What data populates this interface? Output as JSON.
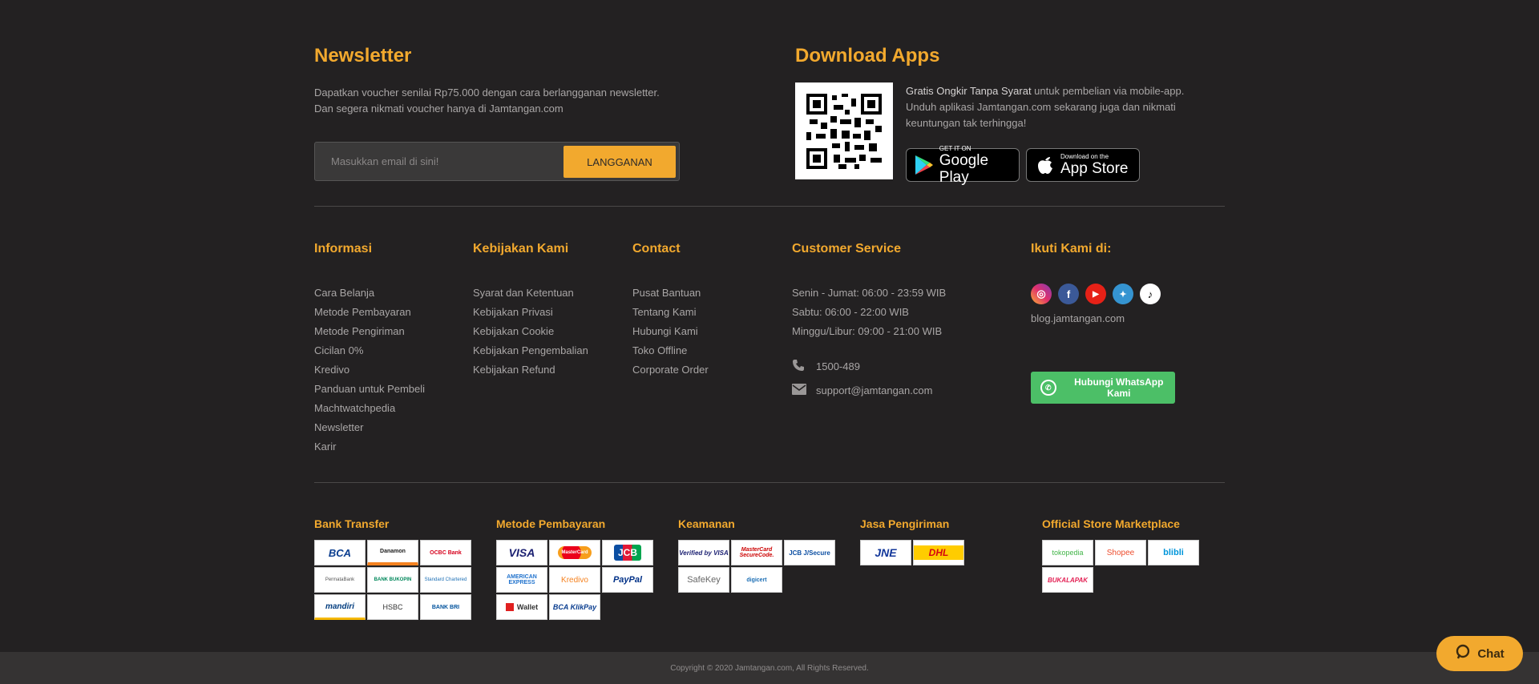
{
  "newsletter": {
    "title": "Newsletter",
    "line1": "Dapatkan voucher senilai Rp75.000 dengan cara berlangganan newsletter.",
    "line2": "Dan segera nikmati voucher hanya di Jamtangan.com",
    "placeholder": "Masukkan email di sini!",
    "button": "LANGGANAN"
  },
  "apps": {
    "title": "Download Apps",
    "highlight": "Gratis Ongkir Tanpa Syarat",
    "rest": " untuk pembelian via mobile-app.",
    "line2": "Unduh aplikasi Jamtangan.com sekarang juga dan nikmati",
    "line3": "keuntungan tak terhingga!",
    "google_small": "GET IT ON",
    "google_big": "Google Play",
    "apple_small": "Download on the",
    "apple_big": "App Store"
  },
  "columns": {
    "informasi": {
      "title": "Informasi",
      "items": [
        "Cara Belanja",
        "Metode Pembayaran",
        "Metode Pengiriman",
        "Cicilan 0%",
        "Kredivo",
        "Panduan untuk Pembeli",
        "Machtwatchpedia",
        "Newsletter",
        "Karir"
      ]
    },
    "kebijakan": {
      "title": "Kebijakan Kami",
      "items": [
        "Syarat dan Ketentuan",
        "Kebijakan Privasi",
        "Kebijakan Cookie",
        "Kebijakan Pengembalian",
        "Kebijakan Refund"
      ]
    },
    "contact": {
      "title": "Contact",
      "items": [
        "Pusat Bantuan",
        "Tentang Kami",
        "Hubungi Kami",
        "Toko Offline",
        "Corporate Order"
      ]
    },
    "cs": {
      "title": "Customer Service",
      "hours": [
        "Senin - Jumat: 06:00 - 23:59 WIB",
        "Sabtu: 06:00 - 22:00 WIB",
        "Minggu/Libur: 09:00 - 21:00 WIB"
      ],
      "phone": "1500-489",
      "email": "support@jamtangan.com"
    },
    "follow": {
      "title": "Ikuti Kami di:",
      "blog": "blog.jamtangan.com",
      "wa_button": "Hubungi WhatsApp Kami"
    }
  },
  "payments": {
    "bank": {
      "title": "Bank Transfer",
      "logos": [
        "BCA",
        "Danamon",
        "OCBC Bank",
        "PermataBank",
        "BANK BUKOPIN",
        "Standard Chartered",
        "mandiri",
        "HSBC",
        "BANK BRI"
      ]
    },
    "metode": {
      "title": "Metode Pembayaran",
      "logos": [
        "VISA",
        "MasterCard",
        "JCB",
        "AMERICAN EXPRESS",
        "Kredivo",
        "PayPal",
        "Wallet",
        "BCA KlikPay"
      ]
    },
    "keamanan": {
      "title": "Keamanan",
      "logos": [
        "Verified by VISA",
        "MasterCard SecureCode.",
        "JCB J/Secure",
        "SafeKey",
        "digicert"
      ]
    },
    "kirim": {
      "title": "Jasa Pengiriman",
      "logos": [
        "JNE",
        "DHL"
      ]
    },
    "store": {
      "title": "Official Store Marketplace",
      "logos": [
        "tokopedia",
        "Shopee",
        "blibli",
        "BUKALAPAK"
      ]
    }
  },
  "footer": {
    "copyright": "Copyright © 2020 Jamtangan.com, All Rights Reserved.",
    "chat": "Chat"
  }
}
